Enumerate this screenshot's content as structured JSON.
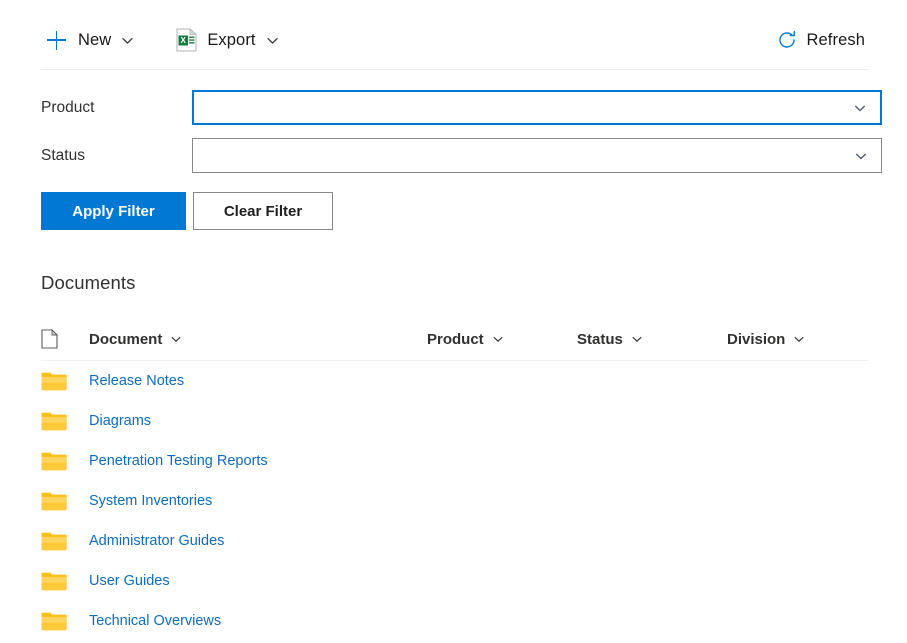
{
  "toolbar": {
    "new_label": "New",
    "new_icon": "plus-icon",
    "new_chevron_icon": "chevron-down-icon",
    "export_label": "Export",
    "export_icon": "excel-file-icon",
    "export_chevron_icon": "chevron-down-icon",
    "refresh_label": "Refresh",
    "refresh_icon": "refresh-circular-arrow-icon"
  },
  "filters": {
    "product": {
      "label": "Product",
      "value": "",
      "placeholder": "",
      "chevron_icon": "chevron-down-icon",
      "focused": true
    },
    "status": {
      "label": "Status",
      "value": "",
      "placeholder": "",
      "chevron_icon": "chevron-down-icon",
      "focused": false
    },
    "apply_label": "Apply Filter",
    "clear_label": "Clear Filter"
  },
  "documents": {
    "section_title": "Documents",
    "columns": [
      {
        "key": "icon",
        "label": "",
        "icon": "file-page-icon"
      },
      {
        "key": "document",
        "label": "Document",
        "chevron_icon": "chevron-down-icon"
      },
      {
        "key": "product",
        "label": "Product",
        "chevron_icon": "chevron-down-icon"
      },
      {
        "key": "status",
        "label": "Status",
        "chevron_icon": "chevron-down-icon"
      },
      {
        "key": "division",
        "label": "Division",
        "chevron_icon": "chevron-down-icon"
      }
    ],
    "rows": [
      {
        "icon": "folder-icon",
        "document": "Release Notes",
        "product": "",
        "status": "",
        "division": ""
      },
      {
        "icon": "folder-icon",
        "document": "Diagrams",
        "product": "",
        "status": "",
        "division": ""
      },
      {
        "icon": "folder-icon",
        "document": "Penetration Testing Reports",
        "product": "",
        "status": "",
        "division": ""
      },
      {
        "icon": "folder-icon",
        "document": "System Inventories",
        "product": "",
        "status": "",
        "division": ""
      },
      {
        "icon": "folder-icon",
        "document": "Administrator Guides",
        "product": "",
        "status": "",
        "division": ""
      },
      {
        "icon": "folder-icon",
        "document": "User Guides",
        "product": "",
        "status": "",
        "division": ""
      },
      {
        "icon": "folder-icon",
        "document": "Technical Overviews",
        "product": "",
        "status": "",
        "division": ""
      }
    ]
  },
  "colors": {
    "accent_blue": "#0078d4",
    "link_blue": "#0f6cbd",
    "folder_yellow": "#ffc107",
    "excel_green": "#107c41",
    "text_dark": "#323130",
    "border_gray": "#8a8886",
    "divider_gray": "#ebebeb"
  }
}
